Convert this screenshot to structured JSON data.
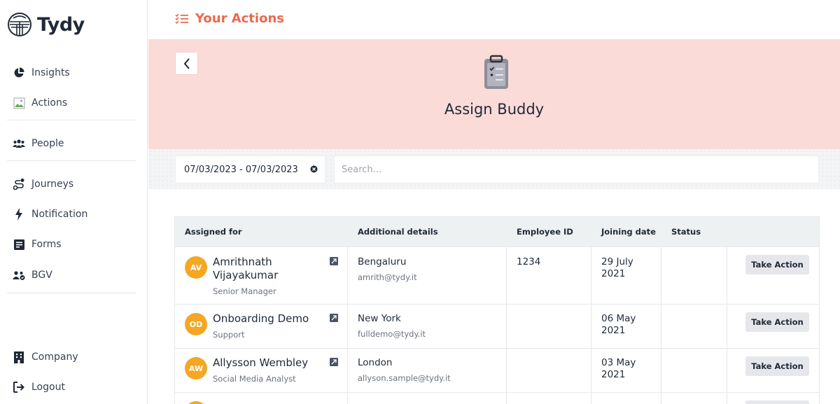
{
  "brand": {
    "name": "Tydy"
  },
  "sidebar": {
    "items": [
      {
        "label": "Insights",
        "icon": "pie-chart-icon"
      },
      {
        "label": "Actions",
        "icon": "broken-image-icon"
      },
      {
        "label": "People",
        "icon": "people-icon"
      },
      {
        "label": "Journeys",
        "icon": "journey-icon"
      },
      {
        "label": "Notification",
        "icon": "bolt-icon"
      },
      {
        "label": "Forms",
        "icon": "form-icon"
      },
      {
        "label": "BGV",
        "icon": "user-check-icon"
      },
      {
        "label": "Company",
        "icon": "building-icon"
      },
      {
        "label": "Logout",
        "icon": "logout-icon"
      }
    ]
  },
  "header": {
    "title": "Your Actions",
    "accent": "#ea6a4f"
  },
  "banner": {
    "title": "Assign Buddy",
    "background": "#fadbd8"
  },
  "filters": {
    "date_range": "07/03/2023 - 07/03/2023",
    "search_placeholder": "Search..."
  },
  "table": {
    "headers": [
      "Assigned for",
      "Additional details",
      "Employee ID",
      "Joining date",
      "Status"
    ],
    "action_label": "Take Action",
    "rows": [
      {
        "initials": "AV",
        "name": "Amrithnath Vijayakumar",
        "role": "Senior Manager",
        "city": "Bengaluru",
        "email": "amrith@tydy.it",
        "employee_id": "1234",
        "joining_date": "29 July 2021",
        "status": ""
      },
      {
        "initials": "OD",
        "name": "Onboarding Demo",
        "role": "Support",
        "city": "New York",
        "email": "fulldemo@tydy.it",
        "employee_id": "",
        "joining_date": "06 May 2021",
        "status": ""
      },
      {
        "initials": "AW",
        "name": "Allysson Wembley",
        "role": "Social Media Analyst",
        "city": "London",
        "email": "allyson.sample@tydy.it",
        "employee_id": "",
        "joining_date": "03 May 2021",
        "status": ""
      }
    ]
  }
}
